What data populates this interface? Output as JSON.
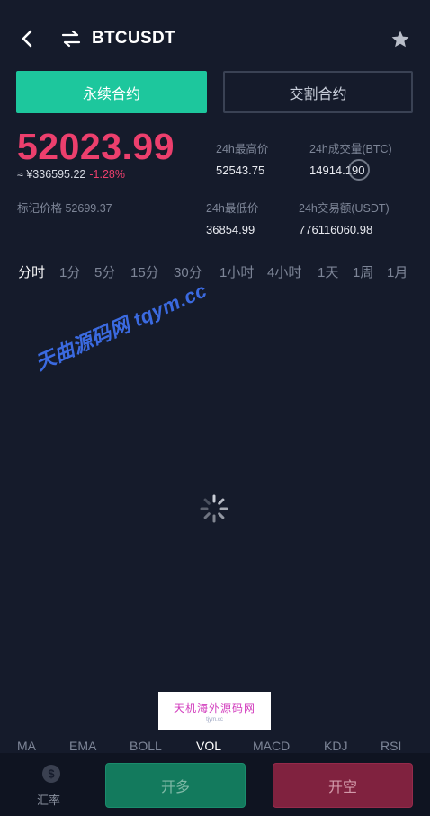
{
  "header": {
    "title": "BTCUSDT",
    "back_icon": "back-arrow-icon",
    "swap_icon": "swap-icon",
    "favorite_icon": "star-icon"
  },
  "tabs": [
    {
      "label": "永续合约",
      "active": true
    },
    {
      "label": "交割合约",
      "active": false
    }
  ],
  "ticker": {
    "last_price": "52023.99",
    "cny_price": "≈ ¥336595.22",
    "change_pct": "-1.28%",
    "mark_price": "标记价格 52699.37",
    "high_24h_label": "24h最高价",
    "high_24h": "52543.75",
    "volume_btc_label": "24h成交量(BTC)",
    "volume_btc": "14914.190",
    "low_24h_label": "24h最低价",
    "low_24h": "36854.99",
    "turnover_usdt_label": "24h交易额(USDT)",
    "turnover_usdt": "776116060.98"
  },
  "timeframes": [
    "分时",
    "1分",
    "5分",
    "15分",
    "30分",
    "1小时",
    "4小时",
    "1天",
    "1周",
    "1月"
  ],
  "active_timeframe": "分时",
  "watermarks": {
    "overlay_text": "天曲源码网 tqym.cc",
    "box_text": "天机海外源码网",
    "box_subtext": "tjym.cc"
  },
  "indicators": [
    "MA",
    "EMA",
    "BOLL",
    "VOL",
    "MACD",
    "KDJ",
    "RSI"
  ],
  "active_indicator": "VOL",
  "bottom": {
    "rate_label": "汇率",
    "rate_icon": "dollar-icon",
    "long_label": "开多",
    "short_label": "开空"
  },
  "colors": {
    "background": "#151b2b",
    "accent_green": "#1dc79d",
    "price_red": "#ec3f6d",
    "long_button": "#137a5d",
    "short_button": "#80223f"
  }
}
